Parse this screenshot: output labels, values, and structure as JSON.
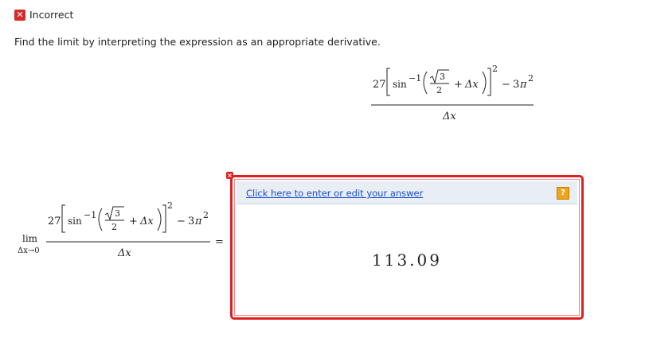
{
  "status": {
    "icon": "x-icon",
    "icon_glyph": "✕",
    "label": "Incorrect",
    "color": "#d62b2b"
  },
  "instruction": "Find the limit by interpreting the expression as an appropriate derivative.",
  "expression": {
    "coef": "27",
    "func": "sin",
    "inv": "−1",
    "sqrt_num": "3",
    "den_two": "2",
    "plus": "+",
    "delta_x": "Δx",
    "power": "2",
    "minus": "−",
    "three": "3",
    "pi": "π",
    "pi_pow": "2",
    "denominator": "Δx"
  },
  "limit": {
    "lim": "lim",
    "sub": "Δx→0",
    "equals": "="
  },
  "answer": {
    "link": "Click here to enter or edit your answer",
    "help_glyph": "?",
    "value": "113.09",
    "close_glyph": "×",
    "border_color": "#e02020"
  }
}
